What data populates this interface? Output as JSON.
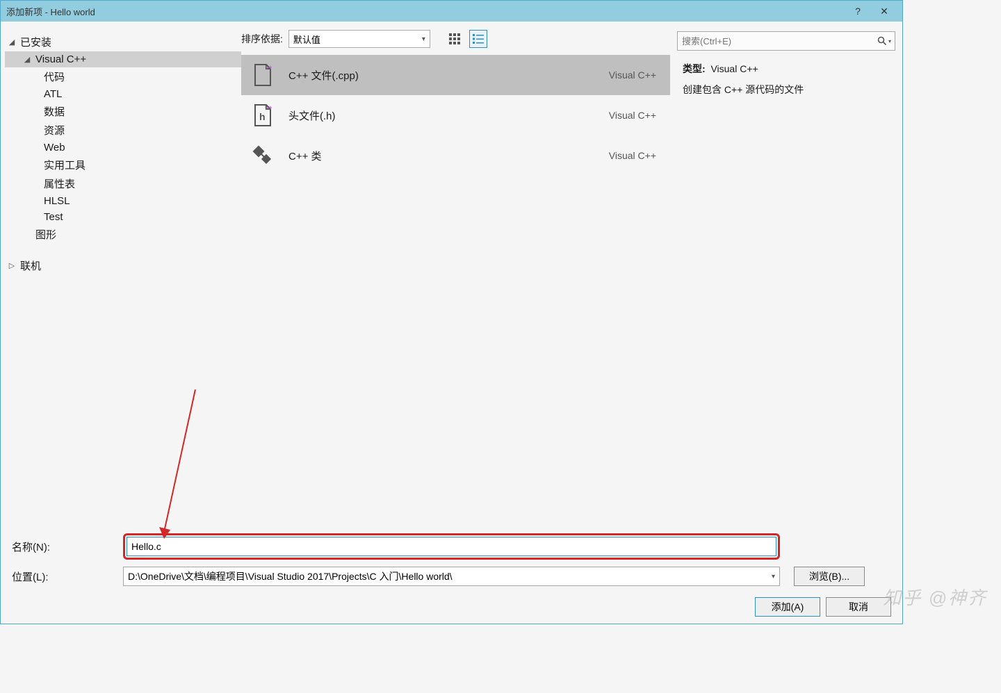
{
  "window": {
    "title": "添加新项 - Hello world",
    "help": "?",
    "close": "✕"
  },
  "sidebar": {
    "installed": "已安装",
    "vcpp": "Visual C++",
    "items": [
      "代码",
      "ATL",
      "数据",
      "资源",
      "Web",
      "实用工具",
      "属性表",
      "HLSL",
      "Test"
    ],
    "graphics": "图形",
    "online": "联机"
  },
  "toolbar": {
    "sort_label": "排序依据:",
    "sort_value": "默认值"
  },
  "list": [
    {
      "label": "C++ 文件(.cpp)",
      "lang": "Visual C++"
    },
    {
      "label": "头文件(.h)",
      "lang": "Visual C++"
    },
    {
      "label": "C++ 类",
      "lang": "Visual C++"
    }
  ],
  "search": {
    "placeholder": "搜索(Ctrl+E)"
  },
  "desc": {
    "type_label": "类型:",
    "type_value": "Visual C++",
    "text": "创建包含 C++ 源代码的文件"
  },
  "footer": {
    "name_label": "名称(N):",
    "name_value": "Hello.c",
    "loc_label": "位置(L):",
    "loc_value": "D:\\OneDrive\\文档\\编程项目\\Visual Studio 2017\\Projects\\C 入门\\Hello world\\",
    "browse": "浏览(B)...",
    "add": "添加(A)",
    "cancel": "取消"
  },
  "watermark": "知乎 @神齐"
}
